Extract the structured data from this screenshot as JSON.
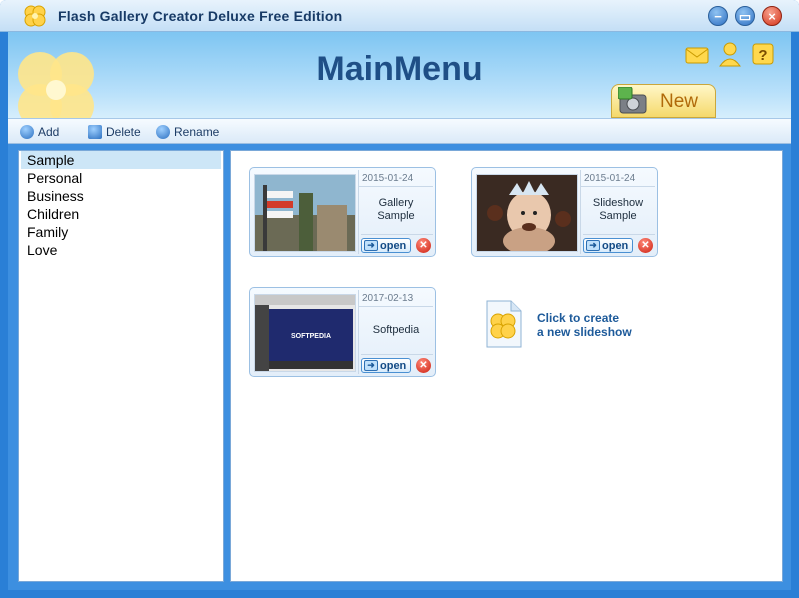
{
  "window": {
    "title": "Flash Gallery Creator Deluxe Free Edition",
    "controls": [
      "minimize",
      "maximize",
      "close"
    ]
  },
  "header": {
    "title": "MainMenu",
    "icons": [
      "mail-icon",
      "user-icon",
      "help-icon"
    ],
    "new_tab_label": "New"
  },
  "toolbar": {
    "add_label": "Add",
    "delete_label": "Delete",
    "rename_label": "Rename"
  },
  "categories": {
    "items": [
      "Sample",
      "Personal",
      "Business",
      "Children",
      "Family",
      "Love"
    ],
    "selected": "Sample"
  },
  "galleries": [
    {
      "date": "2015-01-24",
      "name": "Gallery\nSample",
      "open_label": "open",
      "thumb": "street-signs-photo"
    },
    {
      "date": "2015-01-24",
      "name": "Slideshow\nSample",
      "open_label": "open",
      "thumb": "baby-photo"
    },
    {
      "date": "2017-02-13",
      "name": "Softpedia",
      "open_label": "open",
      "thumb": "softpedia-screenshot",
      "thumb_text": "SOFTPEDIA"
    }
  ],
  "create": {
    "line1": "Click to create",
    "line2": "a new slideshow"
  },
  "colors": {
    "window_frame": "#2a7fd6",
    "header_gradient": "#7ec5f2",
    "title_text": "#1f4f86",
    "selection": "#cde6f7",
    "open_button_text": "#144b86",
    "delete_button": "#cc1f10"
  }
}
